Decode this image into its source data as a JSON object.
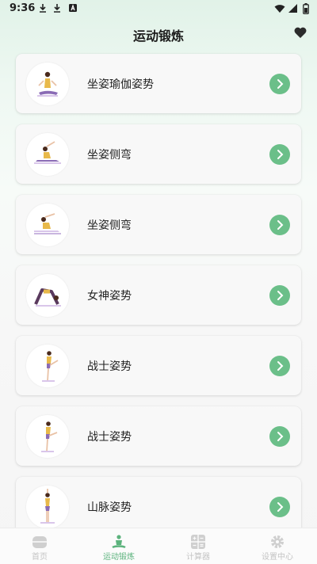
{
  "status_bar": {
    "time": "9:36"
  },
  "header": {
    "title": "运动锻炼",
    "favorite_icon": "heart-icon"
  },
  "exercises": [
    {
      "label": "坐姿瑜伽姿势",
      "pose": "seated-yoga"
    },
    {
      "label": "坐姿侧弯",
      "pose": "seated-side-bend"
    },
    {
      "label": "坐姿侧弯",
      "pose": "seated-side-bend-2"
    },
    {
      "label": "女神姿势",
      "pose": "backbend"
    },
    {
      "label": "战士姿势",
      "pose": "warrior"
    },
    {
      "label": "战士姿势",
      "pose": "warrior-2"
    },
    {
      "label": "山脉姿势",
      "pose": "mountain"
    }
  ],
  "bottom_nav": [
    {
      "label": "首页",
      "icon": "home-icon",
      "active": false
    },
    {
      "label": "运动锻炼",
      "icon": "yoga-icon",
      "active": true
    },
    {
      "label": "计算器",
      "icon": "calculator-icon",
      "active": false
    },
    {
      "label": "设置中心",
      "icon": "gear-icon",
      "active": false
    }
  ],
  "colors": {
    "accent": "#6bbf89",
    "active_nav": "#5cb37d",
    "inactive_nav": "#c4c4c4"
  }
}
